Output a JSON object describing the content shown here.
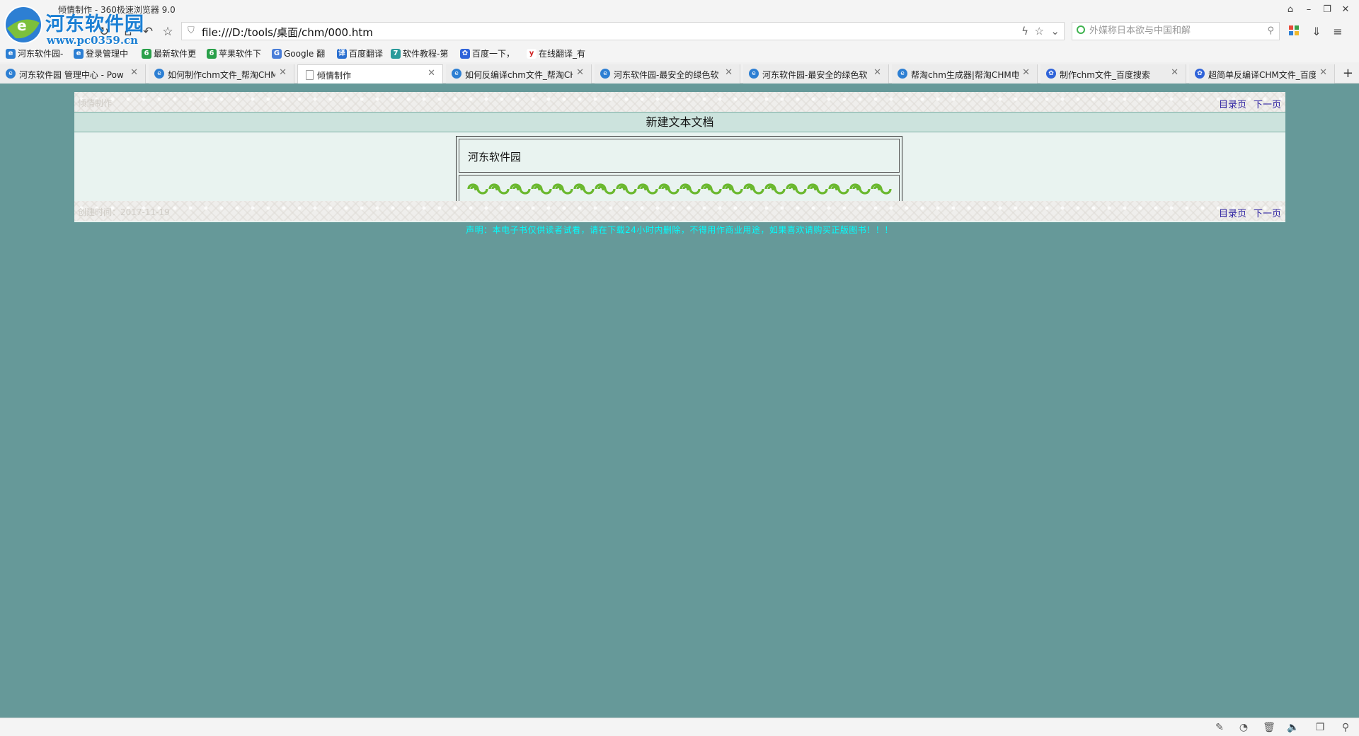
{
  "window": {
    "title": "倾情制作 - 360极速浏览器 9.0",
    "watermark_site": "河东软件园",
    "watermark_url": "www.pc0359.cn"
  },
  "nav": {
    "url": "file:///D:/tools/桌面/chm/000.htm",
    "search_placeholder": "外媒称日本欲与中国和解"
  },
  "bookmarks": [
    {
      "label": "河东软件园-",
      "icon": "pc0359-icon",
      "color": "#2d7fd3"
    },
    {
      "label": "登录管理中",
      "icon": "pc0359-icon",
      "color": "#2d7fd3"
    },
    {
      "label": "最新软件更",
      "icon": "six-icon",
      "color": "#2aa04a"
    },
    {
      "label": "苹果软件下",
      "icon": "six-icon",
      "color": "#2aa04a"
    },
    {
      "label": "Google 翻",
      "icon": "google-translate-icon",
      "color": "#4a7ed8"
    },
    {
      "label": "百度翻译",
      "icon": "baidu-translate-icon",
      "color": "#2a6fd0"
    },
    {
      "label": "软件教程-第",
      "icon": "seven-icon",
      "color": "#2a9a9a"
    },
    {
      "label": "百度一下，",
      "icon": "baidu-paw-icon",
      "color": "#2f63d9"
    },
    {
      "label": "在线翻译_有",
      "icon": "youdao-icon",
      "color": "#d02020"
    }
  ],
  "tabs": [
    {
      "label": "河东软件园 管理中心 - Pow",
      "icon": "pc0359-icon",
      "active": false
    },
    {
      "label": "如何制作chm文件_帮淘CHM",
      "icon": "pc0359-icon",
      "active": false
    },
    {
      "label": "倾情制作",
      "icon": "document-icon",
      "active": true
    },
    {
      "label": "如何反编译chm文件_帮淘CH",
      "icon": "pc0359-icon",
      "active": false
    },
    {
      "label": "河东软件园-最安全的绿色软",
      "icon": "pc0359-icon",
      "active": false
    },
    {
      "label": "河东软件园-最安全的绿色软",
      "icon": "pc0359-icon",
      "active": false
    },
    {
      "label": "帮淘chm生成器|帮淘CHM电",
      "icon": "pc0359-icon",
      "active": false
    },
    {
      "label": "制作chm文件_百度搜索",
      "icon": "baidu-paw-icon",
      "active": false
    },
    {
      "label": "超简单反编译CHM文件_百度",
      "icon": "baidu-paw-icon",
      "active": false
    }
  ],
  "page": {
    "header_left": "倾情制作",
    "toc_link": "目录页",
    "next_link": "下一页",
    "doc_title": "新建文本文档",
    "content_text": "河东软件园",
    "footer_left": "创建时间：2017-11-19",
    "disclaimer": "声明：本电子书仅供读者试看，请在下载24小时内删除，不得用作商业用途，如果喜欢请购买正版图书！！！"
  },
  "colors": {
    "viewport_bg": "#669999",
    "page_bg": "#e9f3f0",
    "header_bar": "#cce3dd",
    "link": "#2a1ea0",
    "disclaimer": "#00ffff",
    "ornament": "#6ab82e"
  }
}
